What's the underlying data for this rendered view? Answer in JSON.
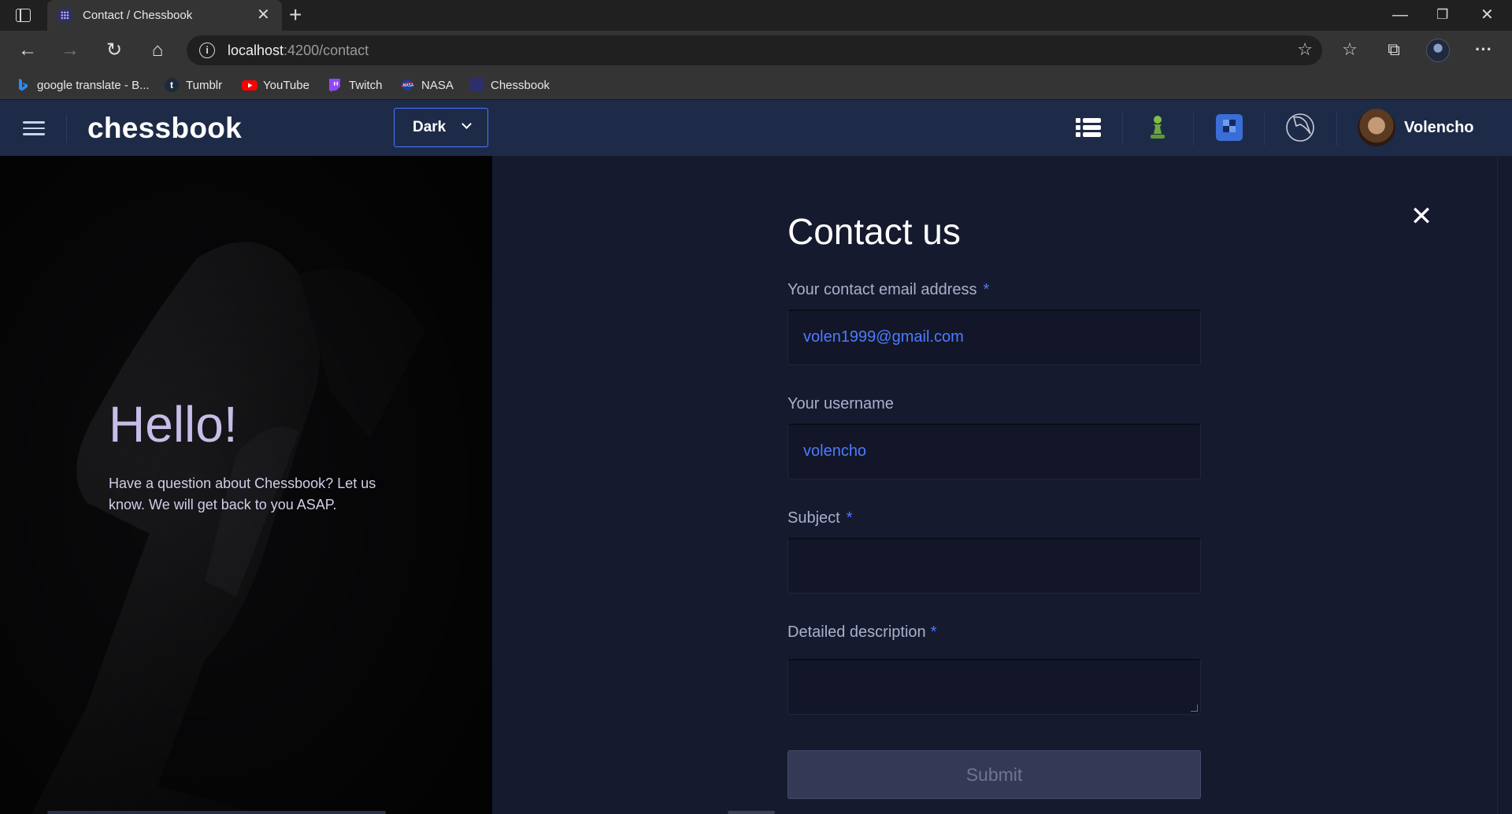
{
  "browser": {
    "tab_title": "Contact / Chessbook",
    "url_host": "localhost",
    "url_path": ":4200/contact",
    "bookmarks": [
      {
        "label": "google translate - B...",
        "icon": "bing-icon"
      },
      {
        "label": "Tumblr",
        "icon": "tumblr-icon"
      },
      {
        "label": "YouTube",
        "icon": "youtube-icon"
      },
      {
        "label": "Twitch",
        "icon": "twitch-icon"
      },
      {
        "label": "NASA",
        "icon": "nasa-icon"
      },
      {
        "label": "Chessbook",
        "icon": "chessbook-icon"
      }
    ]
  },
  "app": {
    "brand": "chessbook",
    "theme_selected": "Dark",
    "username": "Volencho",
    "accent_color": "#4d7bff"
  },
  "hero": {
    "heading": "Hello!",
    "text": "Have a question about Chessbook? Let us know. We will get back to you ASAP."
  },
  "form": {
    "title": "Contact us",
    "email_label": "Your contact email address",
    "email_value": "volen1999@gmail.com",
    "username_label": "Your username",
    "username_value": "volencho",
    "subject_label": "Subject",
    "subject_value": "",
    "description_label": "Detailed description",
    "description_value": "",
    "required_marker": "*",
    "submit_label": "Submit"
  }
}
